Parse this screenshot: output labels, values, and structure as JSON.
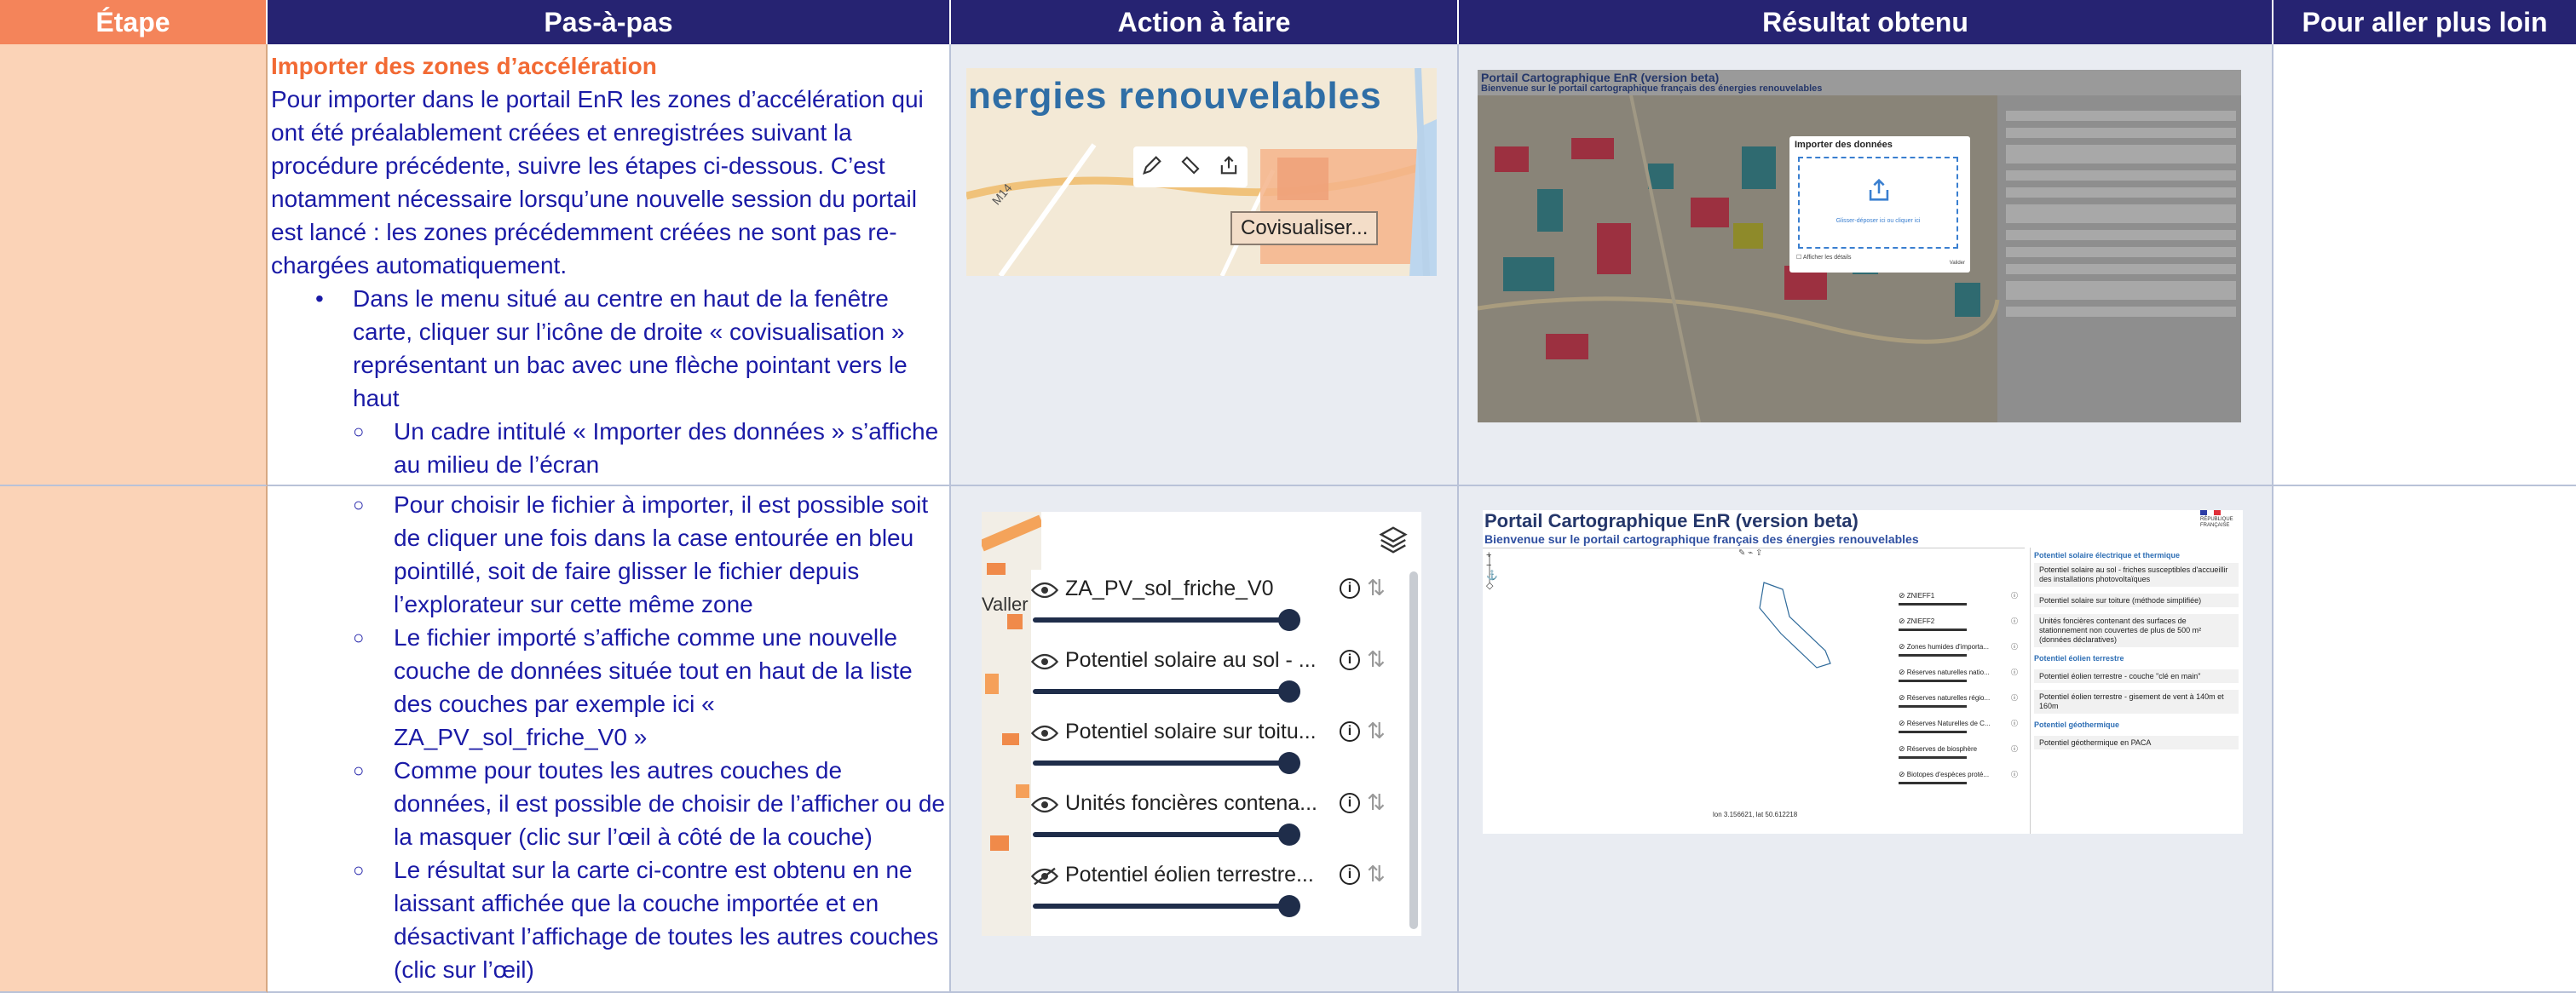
{
  "headers": [
    "Étape",
    "Pas-à-pas",
    "Action à faire",
    "Résultat obtenu",
    "Pour aller plus loin"
  ],
  "row1": {
    "title": "Importer des zones d’accélération",
    "intro": "Pour importer dans le portail EnR les zones d’accélération qui ont été préalablement créées et enregistrées suivant la procédure précédente, suivre les étapes ci-dessous. C’est notamment nécessaire lorsqu’une nouvelle session du portail est lancé : les zones précédemment créées ne sont pas re-chargées automatiquement.",
    "bullet": "Dans le menu situé au centre en haut de la fenêtre carte, cliquer sur l’icône de droite « covisualisation » représentant un bac avec une flèche pointant vers le haut",
    "sub_bullet": "Un cadre intitulé « Importer des données » s’affiche au milieu de l’écran",
    "action": {
      "banner": "nergies renouvelables",
      "road_label": "M14",
      "tooltip": "Covisualiser..."
    },
    "result": {
      "portal_title": "Portail Cartographique EnR (version beta)",
      "portal_subtitle": "Bienvenue sur le portail cartographique français des énergies renouvelables",
      "dialog_title": "Importer des données",
      "dialog_hint": "Glisser-déposer ici ou cliquer ici",
      "dialog_check": "Afficher les détails",
      "dialog_ok": "Valider"
    }
  },
  "row2": {
    "bullets": [
      "Pour choisir le fichier à importer, il est possible soit de cliquer une fois dans la case entourée en bleu pointillé, soit de faire glisser le fichier depuis l’explorateur sur cette même zone",
      "Le fichier importé s’affiche comme une nouvelle couche de données située tout en haut de la liste des couches par exemple ici « ZA_PV_sol_friche_V0 »",
      "Comme pour toutes les autres couches de données, il est possible de choisir de l’afficher ou de la masquer (clic sur l’œil à côté de la couche)",
      "Le résultat sur la carte ci-contre est obtenu en ne laissant affichée que la couche  importée et en désactivant l’affichage de toutes les autres couches (clic sur l’œil)"
    ],
    "action": {
      "map_label": "Valler",
      "layers": [
        {
          "name": "ZA_PV_sol_friche_V0",
          "visible": true
        },
        {
          "name": "Potentiel solaire au sol - ...",
          "visible": true
        },
        {
          "name": "Potentiel solaire sur toitu...",
          "visible": true
        },
        {
          "name": "Unités foncières contena...",
          "visible": true
        },
        {
          "name": "Potentiel éolien terrestre...",
          "visible": false
        }
      ]
    },
    "result": {
      "portal_title": "Portail Cartographique EnR (version beta)",
      "portal_subtitle": "Bienvenue sur le portail cartographique français des énergies renouvelables",
      "logo_text": "RÉPUBLIQUE FRANÇAISE",
      "coords": "lon 3.156621, lat 50.612218",
      "layers": [
        "ZNIEFF1",
        "ZNIEFF2",
        "Zones humides d'importa...",
        "Réserves naturelles natio...",
        "Réserves naturelles régio...",
        "Réserves Naturelles de C...",
        "Réserves de biosphère",
        "Biotopes d'espèces proté..."
      ],
      "panel": {
        "section1": "Potentiel solaire électrique et thermique",
        "item1": "Potentiel solaire au sol - friches susceptibles d'accueillir des installations photovoltaïques",
        "item2": "Potentiel solaire sur toiture (méthode simplifiée)",
        "item3": "Unités foncières contenant des surfaces de stationnement non couvertes de plus de 500 m² (données déclaratives)",
        "section2": "Potentiel éolien terrestre",
        "item4": "Potentiel éolien terrestre - couche \"clé en main\"",
        "item5": "Potentiel éolien terrestre - gisement de vent à 140m et 160m",
        "section3": "Potentiel géothermique",
        "item6": "Potentiel géothermique en PACA"
      }
    }
  },
  "colors": {
    "header": "#262372",
    "etape_header": "#f4845a",
    "etape_cell": "#fbd3b7",
    "text": "#1a1aa6",
    "title": "#f26a34",
    "banner": "#2f6ea6"
  }
}
